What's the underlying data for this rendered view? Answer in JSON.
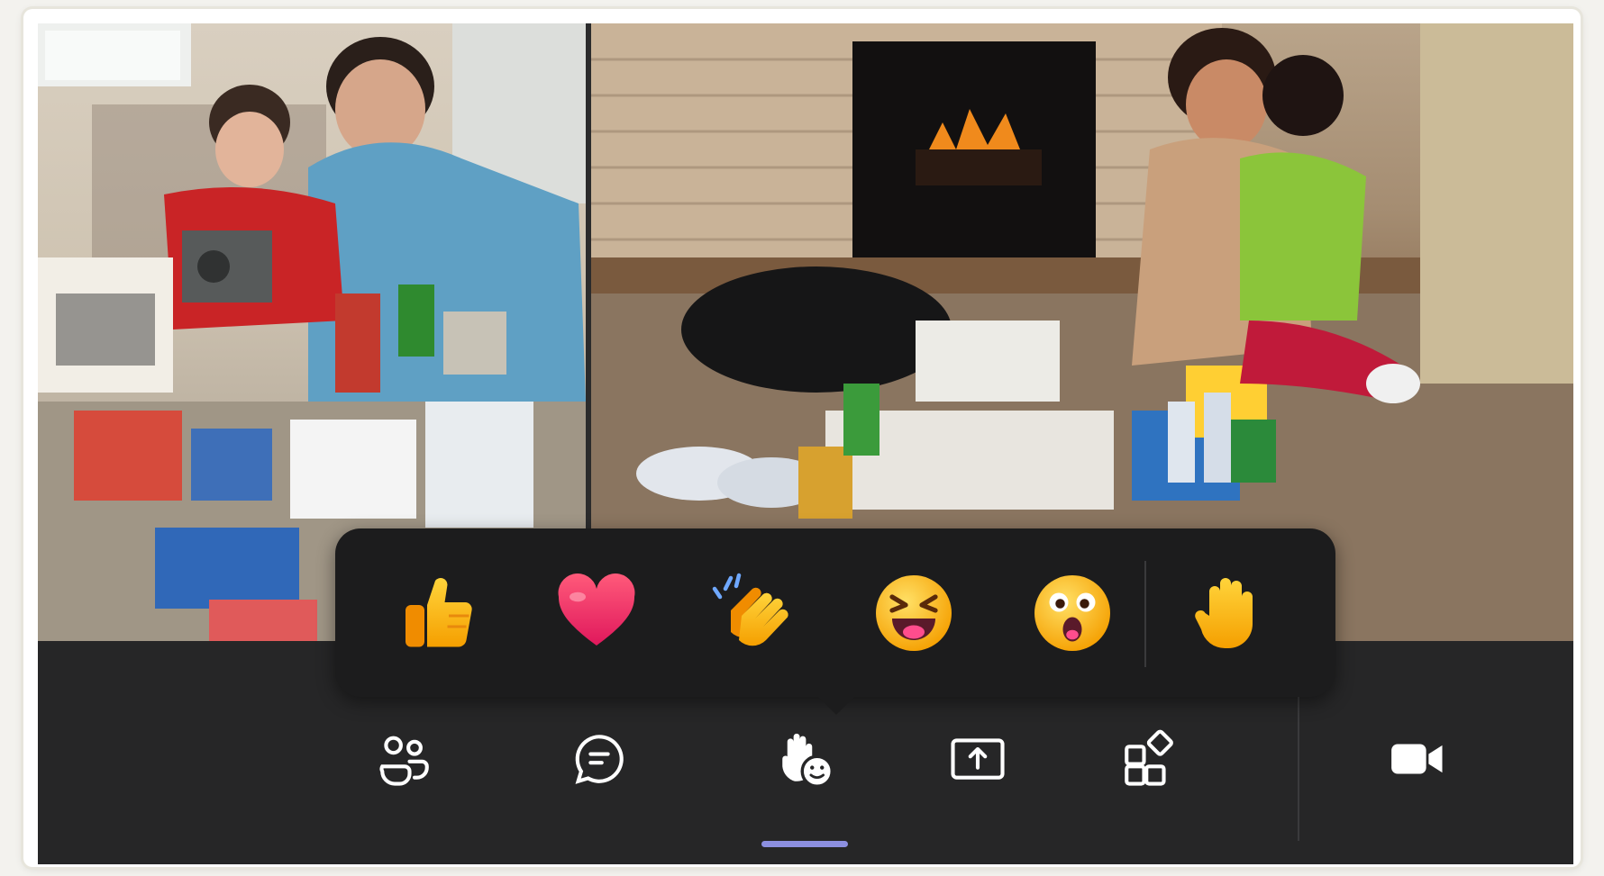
{
  "app": {
    "title": ""
  },
  "video_tiles": [
    {
      "name": "participant-left"
    },
    {
      "name": "participant-right"
    }
  ],
  "reactions": [
    {
      "name": "like",
      "icon": "thumbs-up-icon"
    },
    {
      "name": "love",
      "icon": "heart-icon"
    },
    {
      "name": "applause",
      "icon": "clapping-hands-icon"
    },
    {
      "name": "laugh",
      "icon": "laughing-face-icon"
    },
    {
      "name": "surprised",
      "icon": "surprised-face-icon"
    },
    {
      "name": "raise-hand",
      "icon": "raised-hand-icon"
    }
  ],
  "toolbar": {
    "buttons": [
      {
        "name": "people",
        "icon": "people-icon"
      },
      {
        "name": "chat",
        "icon": "chat-icon"
      },
      {
        "name": "react",
        "icon": "react-icon",
        "active": true
      },
      {
        "name": "share",
        "icon": "share-screen-icon"
      },
      {
        "name": "apps",
        "icon": "apps-icon"
      },
      {
        "name": "camera",
        "icon": "camera-icon"
      }
    ]
  },
  "colors": {
    "toolbar_bg": "#262627",
    "flyout_bg": "#1c1c1d",
    "active_indicator": "#8c8fe0",
    "icon": "#ffffff"
  }
}
